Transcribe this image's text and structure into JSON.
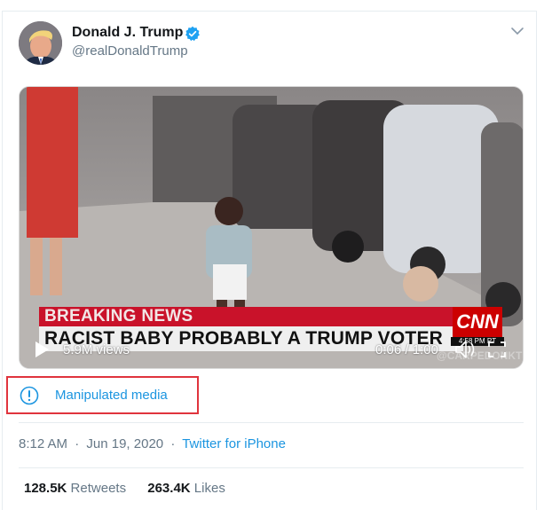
{
  "tweet": {
    "author": {
      "display_name": "Donald J. Trump",
      "handle": "@realDonaldTrump",
      "verified": true,
      "avatar_icon": "avatar-photo"
    },
    "menu_icon": "chevron-down-icon",
    "media": {
      "type": "video",
      "breaking_banner": "BREAKING NEWS",
      "headline_banner": "RACIST BABY PROBABLY A TRUMP VOTER",
      "network_logo": "CNN",
      "network_time": "4:58 PM PT",
      "watermark": "@CARPEDONKTUM",
      "views": "5.9M views",
      "time": "0:06 / 1:00",
      "icons": {
        "play": "play-icon",
        "volume": "volume-icon",
        "fullscreen": "fullscreen-icon"
      }
    },
    "label": {
      "text": "Manipulated media",
      "icon": "exclamation-circle-icon",
      "highlight_color": "#e0343d"
    },
    "meta": {
      "time": "8:12 AM",
      "separator": "·",
      "date": "Jun 19, 2020",
      "source": "Twitter for iPhone"
    },
    "stats": {
      "retweets_count": "128.5K",
      "retweets_label": "Retweets",
      "likes_count": "263.4K",
      "likes_label": "Likes"
    }
  },
  "colors": {
    "link": "#1b95e0",
    "secondary_text": "#657786",
    "primary_text": "#14171a",
    "verified_blue": "#1da1f2",
    "cnn_red": "#cc0000"
  }
}
